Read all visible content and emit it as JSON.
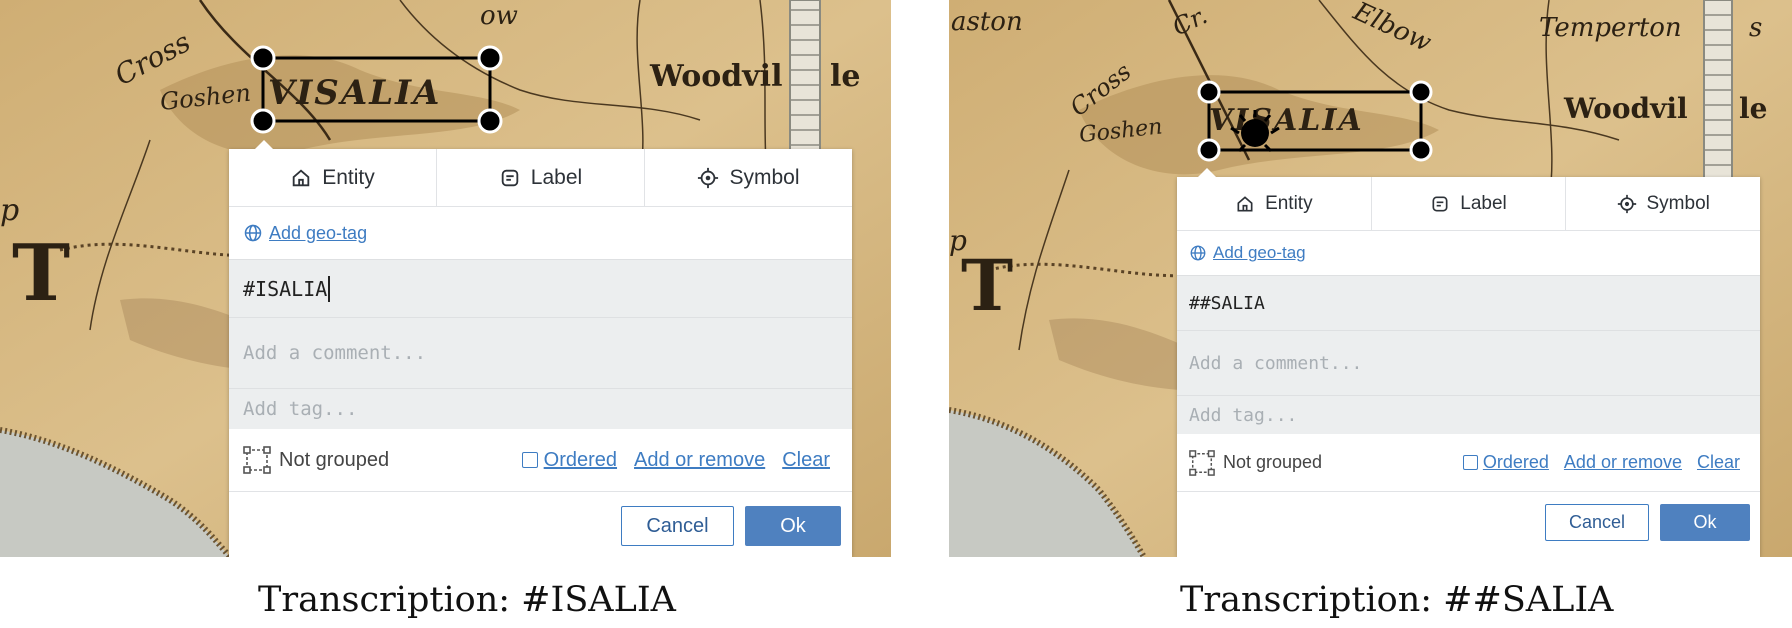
{
  "panels": [
    {
      "tabs": [
        {
          "label": "Entity",
          "icon": "home-icon"
        },
        {
          "label": "Label",
          "icon": "label-icon"
        },
        {
          "label": "Symbol",
          "icon": "crosshair-icon"
        }
      ],
      "geo_tag_label": "Add geo-tag",
      "transcription_value": "#ISALIA",
      "comment_placeholder": "Add a comment...",
      "tag_placeholder": "Add tag...",
      "group_status": "Not grouped",
      "ordered_label": "Ordered",
      "add_remove_label": "Add or remove",
      "clear_label": "Clear",
      "cancel_label": "Cancel",
      "ok_label": "Ok",
      "map_labels": {
        "town": "VISALIA",
        "nearby": "Woodvil",
        "nearby_suffix": "le",
        "river": "Cross",
        "goshen": "Goshen",
        "bow": "ow",
        "letter_t": "T",
        "letter_p": "p"
      },
      "caption": "Transcription: #ISALIA"
    },
    {
      "tabs": [
        {
          "label": "Entity",
          "icon": "home-icon"
        },
        {
          "label": "Label",
          "icon": "label-icon"
        },
        {
          "label": "Symbol",
          "icon": "crosshair-icon"
        }
      ],
      "geo_tag_label": "Add geo-tag",
      "transcription_value": "##SALIA",
      "comment_placeholder": "Add a comment...",
      "tag_placeholder": "Add tag...",
      "group_status": "Not grouped",
      "ordered_label": "Ordered",
      "add_remove_label": "Add or remove",
      "clear_label": "Clear",
      "cancel_label": "Cancel",
      "ok_label": "Ok",
      "map_labels": {
        "town": "VISALIA",
        "nearby": "Woodvil",
        "nearby_suffix": "le",
        "river": "Cross",
        "goshen": "Goshen",
        "elbow": "Elbow",
        "temperton": "Temperton",
        "temperton_suffix": "s",
        "aston": "aston",
        "cr": "Cr.",
        "letter_t": "T",
        "letter_p": "p"
      },
      "caption": "Transcription: ##SALIA"
    }
  ],
  "colors": {
    "accent": "#3e7cc2",
    "ok_button": "#4f81bf",
    "field_bg": "#eceeef",
    "map_paper": "#d8b982"
  }
}
